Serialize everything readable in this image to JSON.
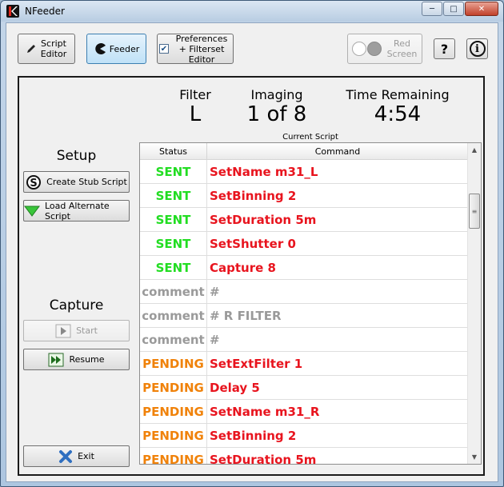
{
  "window": {
    "title": "NFeeder"
  },
  "toolbar": {
    "script_editor": "Script Editor",
    "feeder": "Feeder",
    "preferences": "Preferences + Filterset Editor",
    "preferences_checked": true,
    "red_screen": "Red Screen",
    "help": "?",
    "info": "i"
  },
  "status": {
    "filter_label": "Filter",
    "filter_value": "L",
    "imaging_label": "Imaging",
    "imaging_value": "1 of 8",
    "time_label": "Time Remaining",
    "time_value": "4:54"
  },
  "side": {
    "setup_heading": "Setup",
    "create_stub": "Create Stub Script",
    "load_alternate": "Load Alternate Script",
    "capture_heading": "Capture",
    "start": "Start",
    "resume": "Resume",
    "exit": "Exit"
  },
  "script": {
    "caption": "Current Script",
    "col_status": "Status",
    "col_command": "Command",
    "rows": [
      {
        "status": "SENT",
        "command": "SetName m31_L",
        "kind": "sent"
      },
      {
        "status": "SENT",
        "command": "SetBinning 2",
        "kind": "sent"
      },
      {
        "status": "SENT",
        "command": "SetDuration 5m",
        "kind": "sent"
      },
      {
        "status": "SENT",
        "command": "SetShutter 0",
        "kind": "sent"
      },
      {
        "status": "SENT",
        "command": "Capture 8",
        "kind": "sent"
      },
      {
        "status": "comment",
        "command": "#",
        "kind": "comment"
      },
      {
        "status": "comment",
        "command": "# R FILTER",
        "kind": "comment"
      },
      {
        "status": "comment",
        "command": "#",
        "kind": "comment"
      },
      {
        "status": "PENDING",
        "command": "SetExtFilter 1",
        "kind": "pending"
      },
      {
        "status": "PENDING",
        "command": "Delay 5",
        "kind": "pending"
      },
      {
        "status": "PENDING",
        "command": "SetName m31_R",
        "kind": "pending"
      },
      {
        "status": "PENDING",
        "command": "SetBinning 2",
        "kind": "pending"
      },
      {
        "status": "PENDING",
        "command": "SetDuration 5m",
        "kind": "pending"
      }
    ]
  },
  "colors": {
    "sent": "#22dd22",
    "comment": "#9a9a9a",
    "pending": "#f0820a",
    "command_active": "#e8141e",
    "command_comment": "#9a9a9a"
  }
}
